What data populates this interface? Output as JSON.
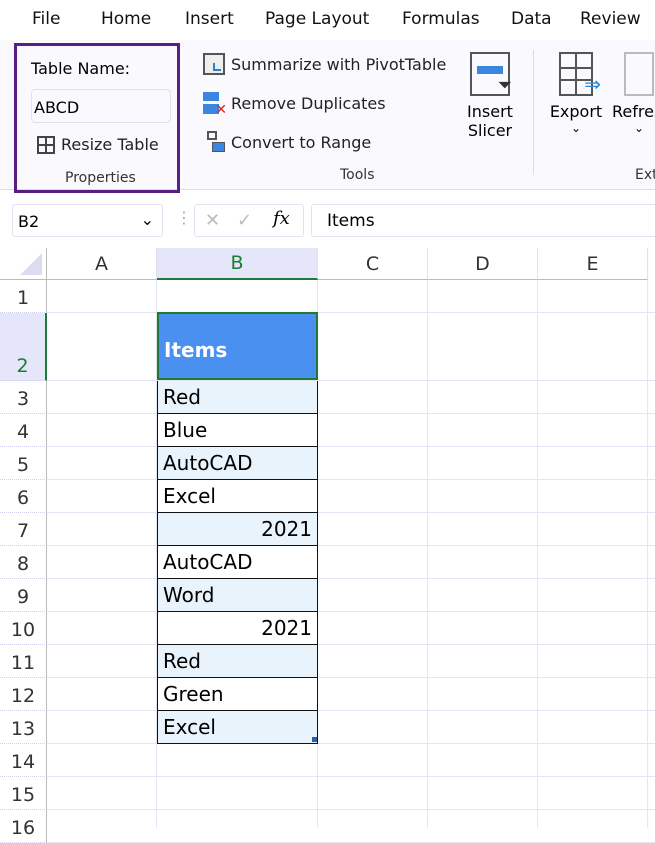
{
  "menu": [
    "File",
    "Home",
    "Insert",
    "Page Layout",
    "Formulas",
    "Data",
    "Review"
  ],
  "properties": {
    "table_name_label": "Table Name:",
    "table_name_value": "ABCD",
    "resize_label": "Resize Table",
    "group_label": "Properties"
  },
  "tools": {
    "summarize_label": "Summarize with PivotTable",
    "remove_dup_label": "Remove Duplicates",
    "convert_label": "Convert to Range",
    "slicer_line1": "Insert",
    "slicer_line2": "Slicer",
    "group_label": "Tools"
  },
  "external": {
    "export_label": "Export",
    "refresh_label": "Refres",
    "group_label": "Ext"
  },
  "formula_bar": {
    "name_box": "B2",
    "fx": "fx",
    "content": "Items"
  },
  "columns": [
    "A",
    "B",
    "C",
    "D",
    "E"
  ],
  "rows": [
    "1",
    "2",
    "3",
    "4",
    "5",
    "6",
    "7",
    "8",
    "9",
    "10",
    "11",
    "12",
    "13",
    "14",
    "15",
    "16"
  ],
  "table": {
    "header": "Items",
    "cells": [
      "Red",
      "Blue",
      "AutoCAD",
      "Excel",
      "2021",
      "AutoCAD",
      "Word",
      "2021",
      "Red",
      "Green",
      "Excel"
    ]
  },
  "colors": {
    "header_fill": "#4a90f0",
    "band_fill": "#e8f3fc",
    "selection": "#1e7b34",
    "highlight_box": "#5a1d82"
  }
}
